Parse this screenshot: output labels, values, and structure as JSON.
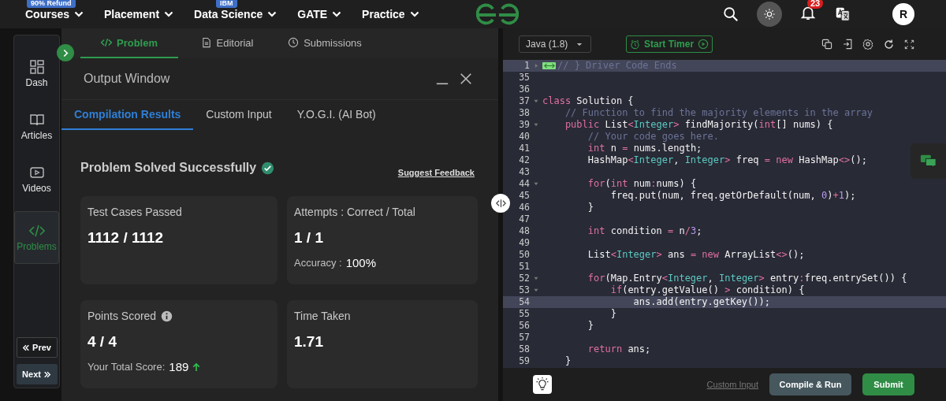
{
  "top_nav": {
    "items": [
      {
        "label": "Courses",
        "badge": "90% Refund"
      },
      {
        "label": "Placement"
      },
      {
        "label": "Data Science",
        "badge": "IBM"
      },
      {
        "label": "GATE"
      },
      {
        "label": "Practice"
      }
    ],
    "notification_count": "23",
    "avatar_initial": "R"
  },
  "sidebar": {
    "items": [
      {
        "label": "Dash",
        "kind": "dash",
        "selected": false
      },
      {
        "label": "Articles",
        "kind": "articles",
        "selected": false
      },
      {
        "label": "Videos",
        "kind": "videos",
        "selected": false
      },
      {
        "label": "Problems",
        "kind": "problems",
        "selected": true
      }
    ],
    "prev_button": "Prev",
    "next_button": "Next"
  },
  "problem_tabs": [
    {
      "label": "Problem",
      "kind": "problem",
      "selected": true
    },
    {
      "label": "Editorial",
      "kind": "editorial",
      "selected": false
    },
    {
      "label": "Submissions",
      "kind": "submissions",
      "selected": false
    }
  ],
  "output_window": {
    "title": "Output Window",
    "tabs": [
      {
        "label": "Compilation Results",
        "selected": true
      },
      {
        "label": "Custom Input",
        "selected": false
      },
      {
        "label": "Y.O.G.I. (AI Bot)",
        "selected": false
      }
    ],
    "status": "Problem Solved Successfully",
    "feedback_link": "Suggest Feedback",
    "cards": [
      {
        "label": "Test Cases Passed",
        "value": "1112 / 1112"
      },
      {
        "label": "Attempts : Correct / Total",
        "value": "1 / 1",
        "sub_label": "Accuracy :",
        "sub_value": "100%"
      },
      {
        "label": "Points Scored",
        "info": true,
        "value": "4 / 4",
        "sub_label": "Your Total Score:",
        "sub_value": "189",
        "trend_up": true
      },
      {
        "label": "Time Taken",
        "value": "1.71"
      }
    ]
  },
  "editor": {
    "language": "Java (1.8)",
    "timer_button": "Start Timer",
    "lines": [
      {
        "num": "1",
        "foldable": true,
        "folded": true,
        "highlighted": true,
        "tokens": [
          {
            "kind": "comment",
            "text": "// } Driver Code Ends"
          }
        ]
      },
      {
        "num": "35",
        "highlighted": false
      },
      {
        "num": "36",
        "highlighted": false
      },
      {
        "num": "37",
        "foldable": true,
        "folded": false,
        "highlighted": false,
        "tokens": [
          {
            "kind": "keyword",
            "text": "class"
          },
          {
            "kind": "plain",
            "text": " Solution {"
          }
        ]
      },
      {
        "num": "38",
        "highlighted": false,
        "tokens": [
          {
            "kind": "comment",
            "text": "    // Function to find the majority elements in the array"
          }
        ]
      },
      {
        "num": "39",
        "foldable": true,
        "folded": false,
        "highlighted": false,
        "tokens": [
          {
            "kind": "keyword",
            "text": "    public"
          },
          {
            "kind": "plain",
            "text": " List"
          },
          {
            "kind": "operator",
            "text": "<"
          },
          {
            "kind": "type",
            "text": "Integer"
          },
          {
            "kind": "operator",
            "text": ">"
          },
          {
            "kind": "plain",
            "text": " findMajority("
          },
          {
            "kind": "keyword",
            "text": "int"
          },
          {
            "kind": "plain",
            "text": "[] nums) {"
          }
        ]
      },
      {
        "num": "40",
        "highlighted": false,
        "tokens": [
          {
            "kind": "comment",
            "text": "        // Your code goes here."
          }
        ]
      },
      {
        "num": "41",
        "highlighted": false,
        "tokens": [
          {
            "kind": "keyword",
            "text": "        int"
          },
          {
            "kind": "plain",
            "text": " n "
          },
          {
            "kind": "operator",
            "text": "="
          },
          {
            "kind": "plain",
            "text": " nums.length;"
          }
        ]
      },
      {
        "num": "42",
        "highlighted": false,
        "tokens": [
          {
            "kind": "plain",
            "text": "        HashMap"
          },
          {
            "kind": "operator",
            "text": "<"
          },
          {
            "kind": "type",
            "text": "Integer"
          },
          {
            "kind": "plain",
            "text": ", "
          },
          {
            "kind": "type",
            "text": "Integer"
          },
          {
            "kind": "operator",
            "text": ">"
          },
          {
            "kind": "plain",
            "text": " freq "
          },
          {
            "kind": "operator",
            "text": "="
          },
          {
            "kind": "keyword",
            "text": " new"
          },
          {
            "kind": "plain",
            "text": " HashMap"
          },
          {
            "kind": "operator",
            "text": "<>"
          },
          {
            "kind": "plain",
            "text": "();"
          }
        ]
      },
      {
        "num": "43",
        "highlighted": false
      },
      {
        "num": "44",
        "foldable": true,
        "folded": false,
        "highlighted": false,
        "tokens": [
          {
            "kind": "keyword",
            "text": "        for"
          },
          {
            "kind": "plain",
            "text": "("
          },
          {
            "kind": "keyword",
            "text": "int"
          },
          {
            "kind": "plain",
            "text": " num"
          },
          {
            "kind": "operator",
            "text": ":"
          },
          {
            "kind": "plain",
            "text": "nums) {"
          }
        ]
      },
      {
        "num": "45",
        "highlighted": false,
        "tokens": [
          {
            "kind": "plain",
            "text": "            freq.put(num, freq.getOrDefault(num, "
          },
          {
            "kind": "number",
            "text": "0"
          },
          {
            "kind": "plain",
            "text": ")"
          },
          {
            "kind": "operator",
            "text": "+"
          },
          {
            "kind": "number",
            "text": "1"
          },
          {
            "kind": "plain",
            "text": ");"
          }
        ]
      },
      {
        "num": "46",
        "highlighted": false,
        "tokens": [
          {
            "kind": "plain",
            "text": "        }"
          }
        ]
      },
      {
        "num": "47",
        "highlighted": false
      },
      {
        "num": "48",
        "highlighted": false,
        "tokens": [
          {
            "kind": "keyword",
            "text": "        int"
          },
          {
            "kind": "plain",
            "text": " condition "
          },
          {
            "kind": "operator",
            "text": "="
          },
          {
            "kind": "plain",
            "text": " n"
          },
          {
            "kind": "operator",
            "text": "/"
          },
          {
            "kind": "number",
            "text": "3"
          },
          {
            "kind": "plain",
            "text": ";"
          }
        ]
      },
      {
        "num": "49",
        "highlighted": false
      },
      {
        "num": "50",
        "highlighted": false,
        "tokens": [
          {
            "kind": "plain",
            "text": "        List"
          },
          {
            "kind": "operator",
            "text": "<"
          },
          {
            "kind": "type",
            "text": "Integer"
          },
          {
            "kind": "operator",
            "text": ">"
          },
          {
            "kind": "plain",
            "text": " ans "
          },
          {
            "kind": "operator",
            "text": "="
          },
          {
            "kind": "keyword",
            "text": " new"
          },
          {
            "kind": "plain",
            "text": " ArrayList"
          },
          {
            "kind": "operator",
            "text": "<>"
          },
          {
            "kind": "plain",
            "text": "();"
          }
        ]
      },
      {
        "num": "51",
        "highlighted": false
      },
      {
        "num": "52",
        "foldable": true,
        "folded": false,
        "highlighted": false,
        "tokens": [
          {
            "kind": "keyword",
            "text": "        for"
          },
          {
            "kind": "plain",
            "text": "(Map.Entry"
          },
          {
            "kind": "operator",
            "text": "<"
          },
          {
            "kind": "type",
            "text": "Integer"
          },
          {
            "kind": "plain",
            "text": ", "
          },
          {
            "kind": "type",
            "text": "Integer"
          },
          {
            "kind": "operator",
            "text": ">"
          },
          {
            "kind": "plain",
            "text": " entry"
          },
          {
            "kind": "operator",
            "text": ":"
          },
          {
            "kind": "plain",
            "text": "freq.entrySet()) {"
          }
        ]
      },
      {
        "num": "53",
        "foldable": true,
        "folded": false,
        "highlighted": false,
        "tokens": [
          {
            "kind": "keyword",
            "text": "            if"
          },
          {
            "kind": "plain",
            "text": "(entry.getValue() "
          },
          {
            "kind": "operator",
            "text": ">"
          },
          {
            "kind": "plain",
            "text": " condition) {"
          }
        ]
      },
      {
        "num": "54",
        "highlighted": true,
        "tokens": [
          {
            "kind": "plain",
            "text": "                ans.add(entry.getKey());"
          }
        ]
      },
      {
        "num": "55",
        "highlighted": false,
        "tokens": [
          {
            "kind": "plain",
            "text": "            }"
          }
        ]
      },
      {
        "num": "56",
        "highlighted": false,
        "tokens": [
          {
            "kind": "plain",
            "text": "        }"
          }
        ]
      },
      {
        "num": "57",
        "highlighted": false
      },
      {
        "num": "58",
        "highlighted": false,
        "tokens": [
          {
            "kind": "keyword",
            "text": "        return"
          },
          {
            "kind": "plain",
            "text": " ans;"
          }
        ]
      },
      {
        "num": "59",
        "highlighted": false,
        "tokens": [
          {
            "kind": "plain",
            "text": "    }"
          }
        ]
      }
    ],
    "custom_input_link": "Custom Input",
    "compile_button": "Compile & Run",
    "submit_button": "Submit"
  }
}
